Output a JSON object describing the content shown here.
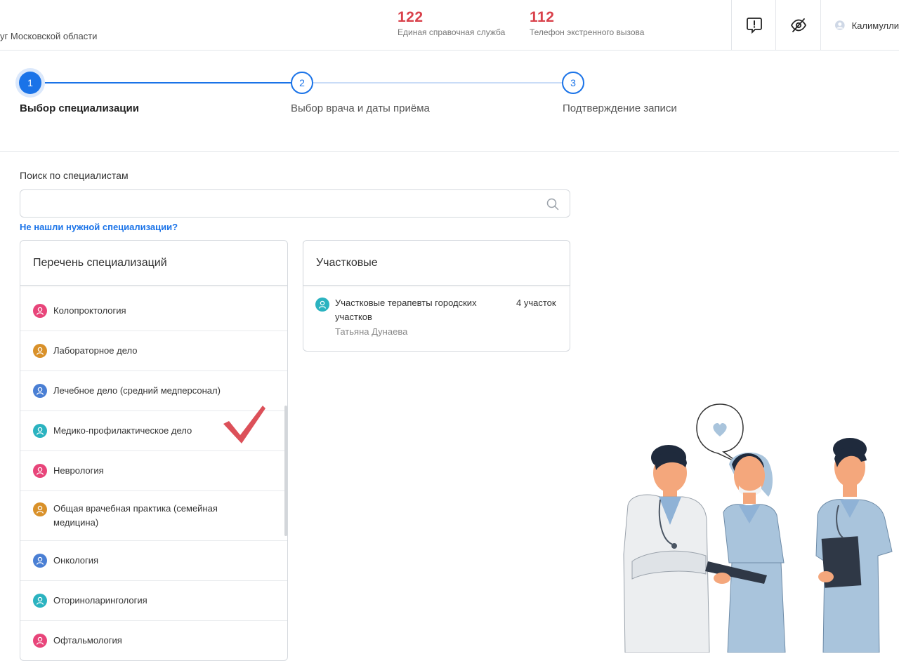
{
  "header": {
    "portal_text": "уг Московской области",
    "hotlines": [
      {
        "number": "122",
        "caption": "Единая справочная служба"
      },
      {
        "number": "112",
        "caption": "Телефон экстренного вызова"
      }
    ],
    "user_name": "Калимулли"
  },
  "stepper": {
    "steps": [
      {
        "num": "1",
        "label": "Выбор специализации",
        "state": "active"
      },
      {
        "num": "2",
        "label": "Выбор врача и даты приёма",
        "state": "todo"
      },
      {
        "num": "3",
        "label": "Подтверждение записи",
        "state": "todo"
      }
    ]
  },
  "search": {
    "label": "Поиск по специалистам",
    "value": "",
    "not_found_link": "Не нашли нужной специализации?"
  },
  "spec_panel": {
    "title": "Перечень специализаций",
    "items": [
      {
        "label": "Колопроктология",
        "color": "#e8457a"
      },
      {
        "label": "Лабораторное дело",
        "color": "#d9912a"
      },
      {
        "label": "Лечебное дело (средний медперсонал)",
        "color": "#4a7fd4"
      },
      {
        "label": "Медико-профилактическое дело",
        "color": "#2bb3c0"
      },
      {
        "label": "Неврология",
        "color": "#e8457a"
      },
      {
        "label": "Общая врачебная практика (семейная медицина)",
        "color": "#d9912a"
      },
      {
        "label": "Онкология",
        "color": "#4a7fd4"
      },
      {
        "label": "Оториноларингология",
        "color": "#2bb3c0"
      },
      {
        "label": "Офтальмология",
        "color": "#e8457a"
      }
    ]
  },
  "uch_panel": {
    "title": "Участковые",
    "item": {
      "title": "Участковые терапевты городских участков",
      "count": "4 участок",
      "person": "Татьяна Дунаева",
      "color": "#2bb3c0"
    }
  },
  "colors": {
    "accent": "#1a73e8",
    "hotline": "#d9414b",
    "check": "#d9414b"
  }
}
